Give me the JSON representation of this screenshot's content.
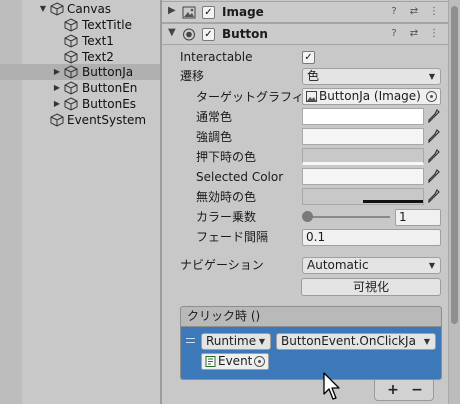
{
  "hierarchy": {
    "items": [
      {
        "label": "Canvas",
        "expanded": true
      },
      {
        "label": "TextTitle"
      },
      {
        "label": "Text1"
      },
      {
        "label": "Text2"
      },
      {
        "label": "ButtonJa",
        "selected": true,
        "collapsed": true
      },
      {
        "label": "ButtonEn",
        "collapsed": true
      },
      {
        "label": "ButtonEs",
        "collapsed": true
      },
      {
        "label": "EventSystem"
      }
    ]
  },
  "inspector": {
    "image_component": {
      "title": "Image",
      "enabled": true
    },
    "button_component": {
      "title": "Button",
      "enabled": true,
      "interactable_label": "Interactable",
      "interactable": true,
      "transition_label": "遷移",
      "transition_value": "色",
      "target_graphic_label": "ターゲットグラフィックス",
      "target_graphic_value": "ButtonJa (Image)",
      "normal_color_label": "通常色",
      "highlight_color_label": "強調色",
      "pressed_color_label": "押下時の色",
      "selected_color_label": "Selected Color",
      "disabled_color_label": "無効時の色",
      "color_multiplier_label": "カラー乗数",
      "color_multiplier_value": "1",
      "color_multiplier_fraction": 0,
      "fade_label": "フェード間隔",
      "fade_value": "0.1",
      "navigation_label": "ナビゲーション",
      "navigation_value": "Automatic",
      "visualize_label": "可視化",
      "onclick_header": "クリック時 ()",
      "runtime_value": "Runtime",
      "function_value": "ButtonEvent.OnClickJa",
      "object_value": "Event!",
      "add_label": "+",
      "remove_label": "−"
    }
  },
  "colors": {
    "selection_row": "#b0b0b0",
    "event_panel": "#3d78b8",
    "panel_bg": "#c8c8c8"
  }
}
